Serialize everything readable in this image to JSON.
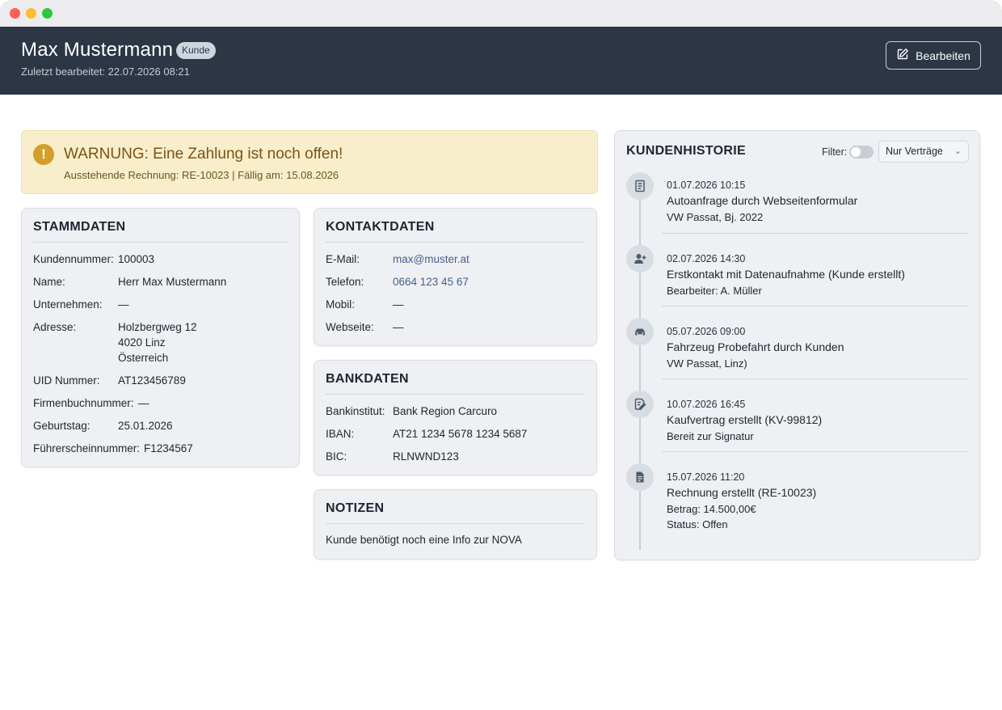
{
  "header": {
    "name": "Max Mustermann",
    "badge": "Kunde",
    "last_edited": "Zuletzt bearbeitet: 22.07.2026 08:21",
    "edit_button": "Bearbeiten"
  },
  "warning": {
    "icon": "!",
    "title": "WARNUNG: Eine Zahlung ist noch offen!",
    "subtitle": "Ausstehende Rechnung: RE-10023 | Fällig am: 15.08.2026"
  },
  "stammdaten": {
    "title": "STAMMDATEN",
    "rows": [
      {
        "label": "Kundennummer:",
        "value": "100003"
      },
      {
        "label": "Name:",
        "value": "Herr Max Mustermann"
      },
      {
        "label": "Unternehmen:",
        "value": "—"
      },
      {
        "label": "Adresse:",
        "value": "Holzbergweg 12",
        "value2": "4020 Linz",
        "value3": "Österreich"
      },
      {
        "label": "UID Nummer:",
        "value": "AT123456789"
      },
      {
        "label": "Firmenbuchnummer:",
        "value": "—"
      },
      {
        "label": "Geburtstag:",
        "value": "25.01.2026"
      },
      {
        "label": "Führerscheinnummer:",
        "value": "F1234567"
      }
    ]
  },
  "kontaktdaten": {
    "title": "KONTAKTDATEN",
    "rows": [
      {
        "label": "E-Mail:",
        "value": "max@muster.at"
      },
      {
        "label": "Telefon:",
        "value": "0664 123 45 67"
      },
      {
        "label": "Mobil:",
        "value": "—"
      },
      {
        "label": "Webseite:",
        "value": "—"
      }
    ]
  },
  "bankdaten": {
    "title": "BANKDATEN",
    "rows": [
      {
        "label": "Bankinstitut:",
        "value": "Bank Region Carcuro"
      },
      {
        "label": "IBAN:",
        "value": "AT21 1234 5678 1234 5687"
      },
      {
        "label": "BIC:",
        "value": "RLNWND123"
      }
    ]
  },
  "notizen": {
    "title": "NOTIZEN",
    "text": "Kunde benötigt noch eine Info zur NOVA"
  },
  "historie": {
    "title": "KUNDENHISTORIE",
    "filter_label": "Filter:",
    "filter_toggle_on": false,
    "filter_select": "Nur Verträge",
    "items": [
      {
        "icon": "document-icon",
        "date": "01.07.2026 10:15",
        "title": "Autoanfrage durch Webseitenformular",
        "lines": [
          "VW Passat, Bj. 2022"
        ]
      },
      {
        "icon": "add-user-icon",
        "date": "02.07.2026 14:30",
        "title": "Erstkontakt mit Datenaufnahme (Kunde erstellt)",
        "lines": [
          "Bearbeiter: A. Müller"
        ]
      },
      {
        "icon": "car-icon",
        "date": "05.07.2026 09:00",
        "title": "Fahrzeug Probefahrt durch Kunden",
        "lines": [
          "VW Passat, Linz)"
        ]
      },
      {
        "icon": "contract-edit-icon",
        "date": "10.07.2026 16:45",
        "title": "Kaufvertrag erstellt (KV-99812)",
        "lines": [
          "Bereit zur Signatur"
        ]
      },
      {
        "icon": "invoice-icon",
        "date": "15.07.2026 11:20",
        "title": "Rechnung erstellt (RE-10023)",
        "lines": [
          "Betrag: 14.500,00€",
          "Status: Offen"
        ]
      }
    ]
  },
  "colors": {
    "header_bg": "#2c3645",
    "warning_bg": "#f9eecb",
    "warning_accent": "#d19f2a",
    "link": "#47618a",
    "card_bg": "#eef0f3"
  }
}
